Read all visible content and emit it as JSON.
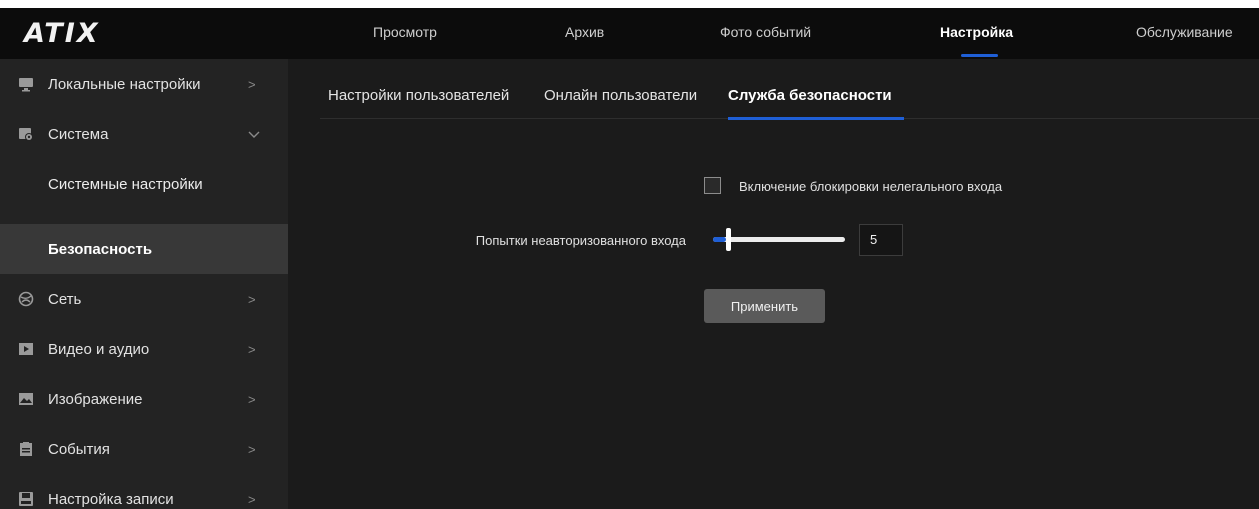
{
  "brand": {
    "logo_text": "ATIX"
  },
  "topnav": {
    "items": [
      {
        "label": "Просмотр"
      },
      {
        "label": "Архив"
      },
      {
        "label": "Фото событий"
      },
      {
        "label": "Настройка",
        "active": true
      },
      {
        "label": "Обслуживание"
      }
    ]
  },
  "sidebar": {
    "items": [
      {
        "label": "Локальные настройки",
        "icon": "monitor-icon",
        "chevron": ">"
      },
      {
        "label": "Система",
        "icon": "system-gear-icon",
        "chevron": "v",
        "expanded": true
      },
      {
        "label": "Системные настройки",
        "sub": true
      },
      {
        "label": "Безопасность",
        "sub": true,
        "selected": true
      },
      {
        "label": "Сеть",
        "icon": "network-icon",
        "chevron": ">"
      },
      {
        "label": "Видео и аудио",
        "icon": "video-icon",
        "chevron": ">"
      },
      {
        "label": "Изображение",
        "icon": "image-icon",
        "chevron": ">"
      },
      {
        "label": "События",
        "icon": "events-clipboard-icon",
        "chevron": ">"
      },
      {
        "label": "Настройка записи",
        "icon": "storage-disk-icon",
        "chevron": ">"
      }
    ]
  },
  "tabs": {
    "items": [
      {
        "label": "Настройки пользователей"
      },
      {
        "label": "Онлайн пользователи"
      },
      {
        "label": "Служба безопасности",
        "active": true
      }
    ]
  },
  "form": {
    "lockout_checkbox_label": "Включение блокировки нелегального входа",
    "lockout_checked": false,
    "attempts_label": "Попытки неавторизованного входа",
    "attempts_value": "5",
    "attempts_slider_fraction": 0.1,
    "apply_label": "Применить"
  },
  "colors": {
    "accent": "#1f5fd6",
    "background": "#1b1b1b",
    "sidebar": "#232323",
    "topbar": "#0c0c0c"
  }
}
